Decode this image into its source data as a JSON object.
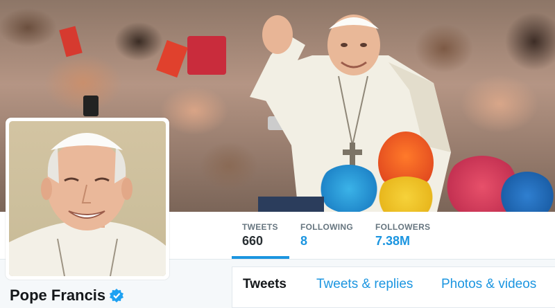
{
  "profile": {
    "name": "Pope Francis",
    "verified": true
  },
  "stats": [
    {
      "label": "TWEETS",
      "value": "660"
    },
    {
      "label": "FOLLOWING",
      "value": "8"
    },
    {
      "label": "FOLLOWERS",
      "value": "7.38M"
    }
  ],
  "tabs": [
    {
      "label": "Tweets"
    },
    {
      "label": "Tweets & replies"
    },
    {
      "label": "Photos & videos"
    }
  ],
  "icons": {
    "verified": "verified-badge-icon"
  },
  "colors": {
    "accent": "#1b95e0",
    "text_dark": "#14171a",
    "muted": "#66757f",
    "card_bg": "#ffffff",
    "page_bg": "#f5f8fa"
  }
}
